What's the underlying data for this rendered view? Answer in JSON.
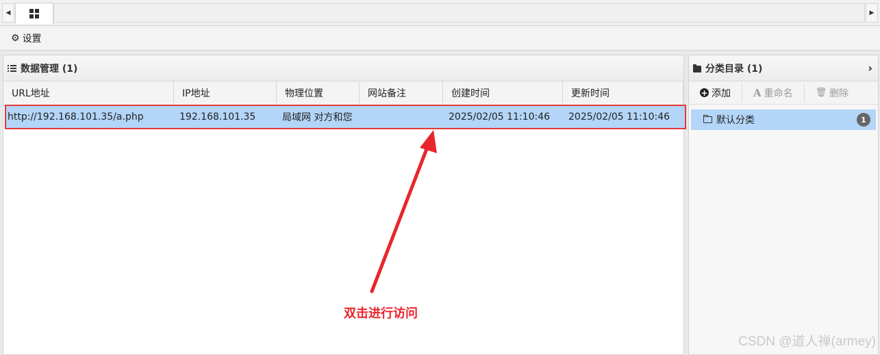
{
  "toolbar": {
    "settings_label": "设置"
  },
  "data_panel": {
    "title": "数据管理 (1)",
    "columns": [
      "URL地址",
      "IP地址",
      "物理位置",
      "网站备注",
      "创建时间",
      "更新时间"
    ],
    "rows": [
      {
        "url": "http://192.168.101.35/a.php",
        "ip": "192.168.101.35",
        "location": "局域网 对方和您",
        "note": "",
        "created": "2025/02/05 11:10:46",
        "updated": "2025/02/05 11:10:46"
      }
    ]
  },
  "annotation": {
    "text": "双击进行访问",
    "color": "#e8262c"
  },
  "category_panel": {
    "title": "分类目录 (1)",
    "add_label": "添加",
    "rename_label": "重命名",
    "delete_label": "删除",
    "items": [
      {
        "label": "默认分类",
        "count": "1"
      }
    ]
  },
  "watermark": "CSDN @道人禅(armey)",
  "colors": {
    "selection": "#b3d5f7",
    "highlight_border": "#e53935"
  },
  "icons": {
    "tab_home": "grid-icon",
    "settings": "gear-icon",
    "data_panel": "list-icon",
    "category_panel": "folder-icon",
    "add": "plus-circle-icon",
    "rename": "font-icon",
    "delete": "trash-icon",
    "category_item": "folder-outline-icon"
  }
}
